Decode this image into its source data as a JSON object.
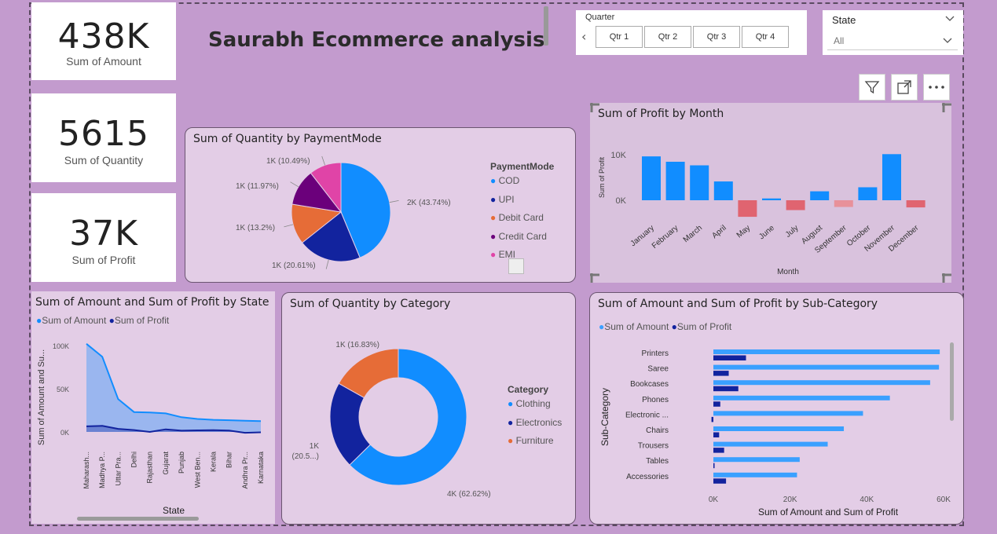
{
  "kpis": [
    {
      "value": "438K",
      "label": "Sum of Amount"
    },
    {
      "value": "5615",
      "label": "Sum of Quantity"
    },
    {
      "value": "37K",
      "label": "Sum of Profit"
    }
  ],
  "title": "Saurabh Ecommerce analysis",
  "quarter_slicer": {
    "title": "Quarter",
    "options": [
      "Qtr 1",
      "Qtr 2",
      "Qtr 3",
      "Qtr 4"
    ]
  },
  "state_slicer": {
    "title": "State",
    "value": "All"
  },
  "colors": {
    "bg": "#c39bce",
    "card": "#e3cde6",
    "cod": "#118dff",
    "upi": "#12239e",
    "debit": "#e66c37",
    "credit": "#6b007b",
    "emi": "#e044a7",
    "neg": "#e06470",
    "amount": "#3aa0ff",
    "profit": "#12239e"
  },
  "payment_chart": {
    "title": "Sum of Quantity by PaymentMode",
    "legend_title": "PaymentMode",
    "legend": [
      "COD",
      "UPI",
      "Debit Card",
      "Credit Card",
      "EMI"
    ]
  },
  "month_chart": {
    "title": "Sum of Profit by Month",
    "ylabel": "Sum of Profit",
    "xlabel": "Month",
    "ticks": [
      "10K",
      "0K"
    ]
  },
  "state_chart": {
    "title": "Sum of Amount and Sum of Profit by State",
    "legend": [
      "Sum of Amount",
      "Sum of Profit"
    ],
    "ylabel": "Sum of Amount and Su...",
    "xlabel": "State",
    "ticks": [
      "100K",
      "50K",
      "0K"
    ]
  },
  "category_chart": {
    "title": "Sum of Quantity by Category",
    "legend_title": "Category",
    "legend": [
      "Clothing",
      "Electronics",
      "Furniture"
    ]
  },
  "subcat_chart": {
    "title": "Sum of Amount and Sum of Profit by Sub-Category",
    "legend": [
      "Sum of Amount",
      "Sum of Profit"
    ],
    "ylabel": "Sub-Category",
    "xlabel": "Sum of Amount and Sum of Profit",
    "ticks": [
      "0K",
      "20K",
      "40K",
      "60K"
    ]
  },
  "chart_data": [
    {
      "type": "pie",
      "title": "Sum of Quantity by PaymentMode",
      "categories": [
        "COD",
        "UPI",
        "Debit Card",
        "Credit Card",
        "EMI"
      ],
      "values": [
        43.74,
        20.61,
        13.2,
        11.97,
        10.49
      ],
      "labels": [
        "2K (43.74%)",
        "1K (20.61%)",
        "1K (13.2%)",
        "1K (11.97%)",
        "1K (10.49%)"
      ]
    },
    {
      "type": "bar",
      "title": "Sum of Profit by Month",
      "categories": [
        "January",
        "February",
        "March",
        "April",
        "May",
        "June",
        "July",
        "August",
        "September",
        "October",
        "November",
        "December"
      ],
      "values": [
        9800,
        8600,
        7800,
        4200,
        -3700,
        400,
        -2200,
        2000,
        -1500,
        2900,
        10300,
        -1600
      ],
      "ylabel": "Sum of Profit",
      "xlabel": "Month",
      "ylim": [
        -5000,
        12000
      ]
    },
    {
      "type": "area",
      "title": "Sum of Amount and Sum of Profit by State",
      "categories": [
        "Maharash...",
        "Madhya P...",
        "Uttar Pra...",
        "Delhi",
        "Rajasthan",
        "Gujarat",
        "Punjab",
        "West Ben...",
        "Kerala",
        "Bihar",
        "Andhra Pr...",
        "Karnataka"
      ],
      "series": [
        {
          "name": "Sum of Amount",
          "values": [
            102000,
            87000,
            38000,
            23000,
            22500,
            21500,
            17000,
            15000,
            14000,
            13500,
            13000,
            12500
          ]
        },
        {
          "name": "Sum of Profit",
          "values": [
            6500,
            7000,
            3500,
            2200,
            0,
            3000,
            1500,
            1800,
            2000,
            1600,
            -1000,
            -500
          ]
        }
      ],
      "ylabel": "Sum of Amount and Su...",
      "xlabel": "State",
      "ylim": [
        -5000,
        110000
      ]
    },
    {
      "type": "pie",
      "title": "Sum of Quantity by Category",
      "categories": [
        "Clothing",
        "Electronics",
        "Furniture"
      ],
      "values": [
        62.62,
        20.55,
        16.83
      ],
      "labels": [
        "4K (62.62%)",
        "1K (20.5...)",
        "1K (16.83%)"
      ]
    },
    {
      "type": "bar",
      "title": "Sum of Amount and Sum of Profit by Sub-Category",
      "categories": [
        "Printers",
        "Saree",
        "Bookcases",
        "Phones",
        "Electronic ...",
        "Chairs",
        "Trousers",
        "Tables",
        "Accessories"
      ],
      "series": [
        {
          "name": "Sum of Amount",
          "values": [
            59000,
            58800,
            56500,
            46000,
            39000,
            34000,
            29800,
            22500,
            21800
          ]
        },
        {
          "name": "Sum of Profit",
          "values": [
            8500,
            4000,
            6500,
            1800,
            -500,
            1500,
            2800,
            0,
            3300
          ]
        }
      ],
      "ylabel": "Sub-Category",
      "xlabel": "Sum of Amount and Sum of Profit",
      "xlim": [
        0,
        60000
      ]
    }
  ]
}
